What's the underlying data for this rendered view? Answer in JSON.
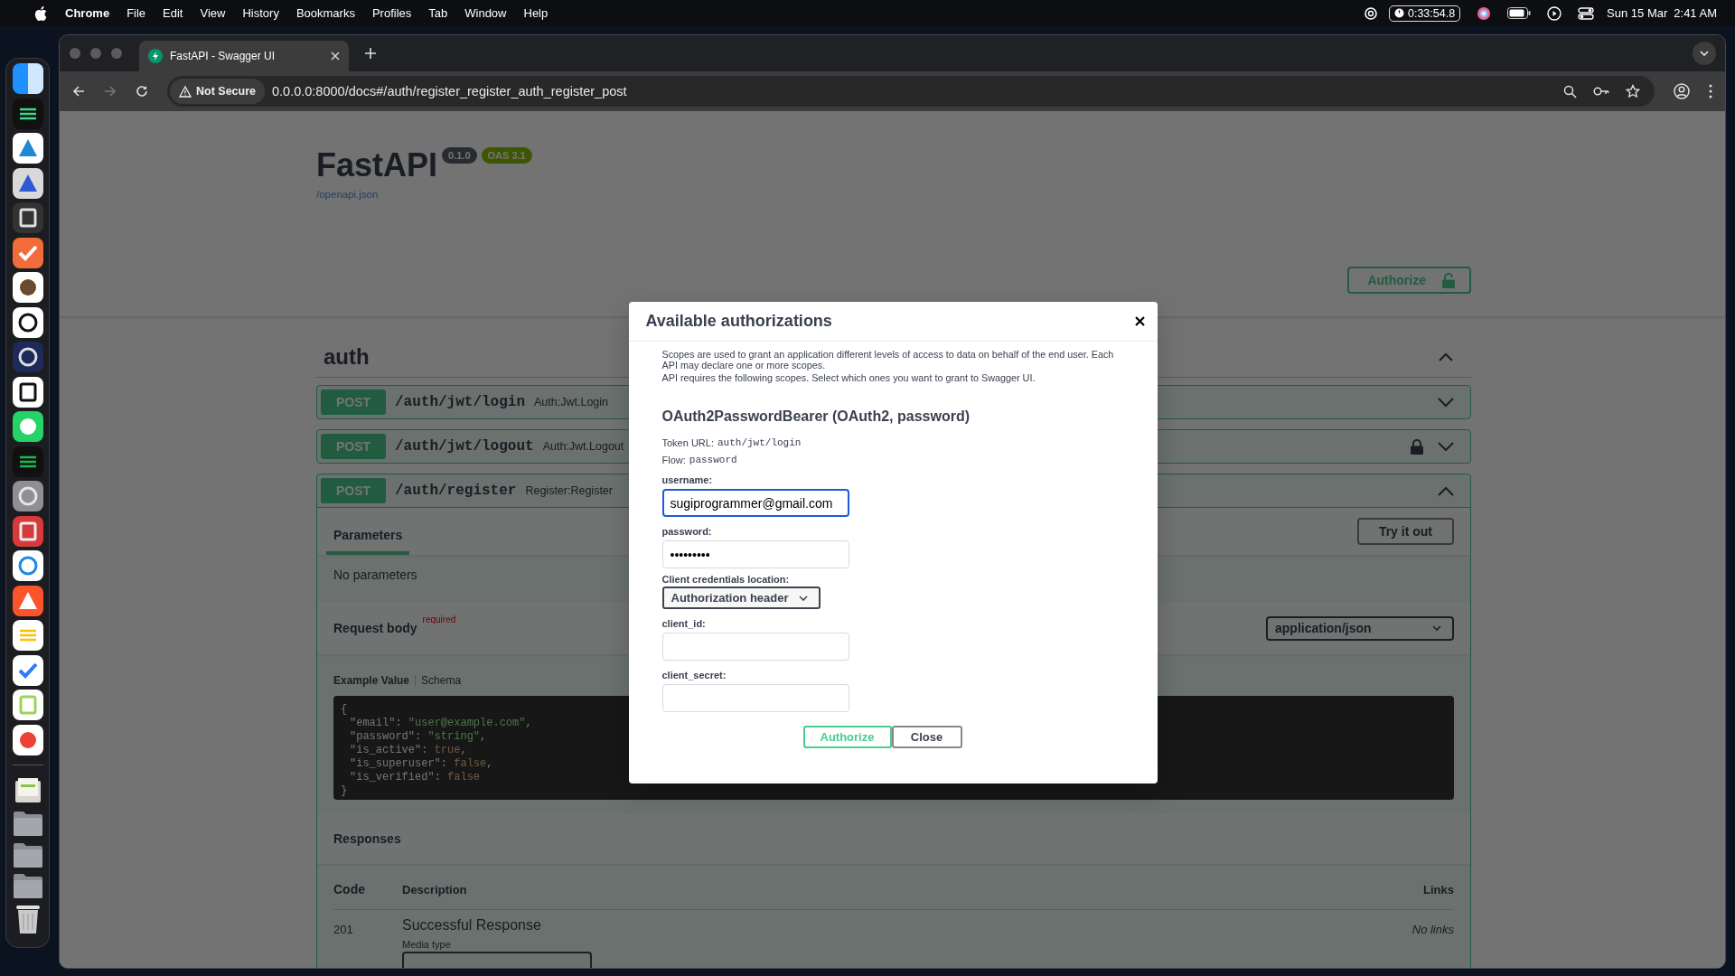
{
  "menu_bar": {
    "app_name": "Chrome",
    "menus": [
      "File",
      "Edit",
      "View",
      "History",
      "Bookmarks",
      "Profiles",
      "Tab",
      "Window",
      "Help"
    ],
    "timer": "0:33:54.8",
    "date": "Sun 15 Mar",
    "time": "2:41 AM"
  },
  "browser": {
    "tabs": [
      {
        "title": "FastAPI - Swagger UI",
        "selected": true
      }
    ],
    "security_label": "Not Secure",
    "url": "0.0.0.0:8000/docs#/auth/register_register_auth_register_post"
  },
  "page": {
    "title": "FastAPI",
    "badges": [
      {
        "text": "0.1.0",
        "kind": "version"
      },
      {
        "text": "OAS 3.1",
        "kind": "oas"
      }
    ],
    "spec_link": "/openapi.json",
    "authorize_button": "Authorize",
    "tag": {
      "name": "auth",
      "expanded": true
    },
    "operations": [
      {
        "method": "POST",
        "path": "/auth/jwt/login",
        "summary": "Auth:Jwt.Login",
        "locked": false,
        "expanded": false
      },
      {
        "method": "POST",
        "path": "/auth/jwt/logout",
        "summary": "Auth:Jwt.Logout",
        "locked": true,
        "expanded": false
      },
      {
        "method": "POST",
        "path": "/auth/register",
        "summary": "Register:Register",
        "locked": false,
        "expanded": true
      }
    ],
    "detail": {
      "tabs": [
        {
          "label": "Parameters",
          "selected": true
        }
      ],
      "try_button": "Try it out",
      "no_params": "No parameters",
      "request_body": "Request body",
      "required": "required",
      "content_type": "application/json",
      "example_tabs": [
        {
          "label": "Example Value",
          "selected": true
        },
        {
          "label": "Schema",
          "selected": false
        }
      ],
      "code": {
        "open": "{",
        "close": "}",
        "lines": [
          [
            {
              "text": "\"email\"",
              "kind": "key"
            },
            {
              "text": ": ",
              "kind": "punct"
            },
            {
              "text": "\"user@example.com\"",
              "kind": "string"
            },
            {
              "text": ",",
              "kind": "punct"
            }
          ],
          [
            {
              "text": "\"password\"",
              "kind": "key"
            },
            {
              "text": ": ",
              "kind": "punct"
            },
            {
              "text": "\"string\"",
              "kind": "string"
            },
            {
              "text": ",",
              "kind": "punct"
            }
          ],
          [
            {
              "text": "\"is_active\"",
              "kind": "key"
            },
            {
              "text": ": ",
              "kind": "punct"
            },
            {
              "text": "true",
              "kind": "literal"
            },
            {
              "text": ",",
              "kind": "punct"
            }
          ],
          [
            {
              "text": "\"is_superuser\"",
              "kind": "key"
            },
            {
              "text": ": ",
              "kind": "punct"
            },
            {
              "text": "false",
              "kind": "literal"
            },
            {
              "text": ",",
              "kind": "punct"
            }
          ],
          [
            {
              "text": "\"is_verified\"",
              "kind": "key"
            },
            {
              "text": ": ",
              "kind": "punct"
            },
            {
              "text": "false",
              "kind": "literal"
            }
          ]
        ]
      },
      "responses_title": "Responses",
      "columns": [
        "Code",
        "Description",
        "Links"
      ],
      "responses": [
        {
          "code": "201",
          "description": "Successful Response",
          "media_type_label": "Media type",
          "links": "No links"
        }
      ]
    }
  },
  "modal": {
    "title": "Available authorizations",
    "description": [
      "Scopes are used to grant an application different levels of access to data on behalf of the end user. Each API may declare one or more scopes.",
      "API requires the following scopes. Select which ones you want to grant to Swagger UI."
    ],
    "scheme": "OAuth2PasswordBearer (OAuth2, password)",
    "token_url_label": "Token URL:",
    "token_url": "auth/jwt/login",
    "flow_label": "Flow:",
    "flow": "password",
    "fields": [
      {
        "label": "username:",
        "kind": "input",
        "value": "sugiprogrammer@gmail.com",
        "focused": true
      },
      {
        "label": "password:",
        "kind": "input",
        "value": "•••••••••",
        "focused": false
      },
      {
        "label": "Client credentials location:",
        "kind": "select",
        "value": "Authorization header"
      },
      {
        "label": "client_id:",
        "kind": "input",
        "focused": false
      },
      {
        "label": "client_secret:",
        "kind": "input",
        "focused": false
      }
    ],
    "buttons": [
      {
        "label": "Authorize",
        "kind": "primary"
      },
      {
        "label": "Close",
        "kind": "secondary"
      }
    ]
  }
}
